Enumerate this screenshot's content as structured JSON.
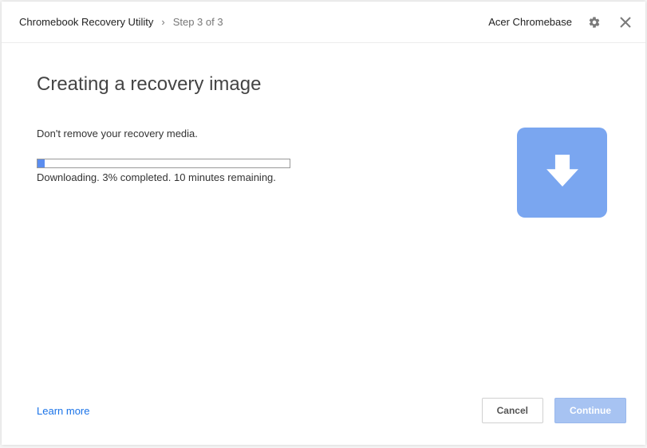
{
  "header": {
    "app_name": "Chromebook Recovery Utility",
    "step_label": "Step 3 of 3",
    "device_name": "Acer Chromebase"
  },
  "main": {
    "title": "Creating a recovery image",
    "instruction": "Don't remove your recovery media.",
    "progress_percent": 3,
    "status_text": "Downloading. 3% completed. 10 minutes remaining."
  },
  "footer": {
    "learn_more_label": "Learn more",
    "cancel_label": "Cancel",
    "continue_label": "Continue"
  }
}
